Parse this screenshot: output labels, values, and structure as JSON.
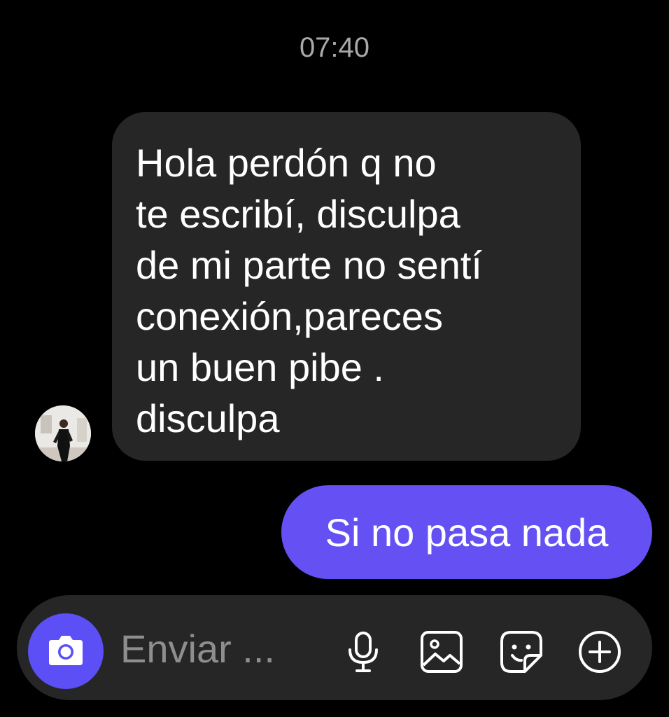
{
  "conversation": {
    "timestamp": "07:40"
  },
  "incoming_message": {
    "lines": [
      "Hola perdón q no",
      "te escribí, disculpa",
      "de mi parte no sentí",
      "conexión,pareces",
      "un buen pibe .",
      "disculpa"
    ]
  },
  "outgoing_message": {
    "text": "Si no pasa nada"
  },
  "composer": {
    "placeholder": "Enviar ...",
    "icons": [
      "camera-icon",
      "microphone-icon",
      "gallery-icon",
      "sticker-icon",
      "plus-icon"
    ]
  },
  "colors": {
    "background": "#000000",
    "incoming_bubble": "#262626",
    "outgoing_bubble": "#6551f3",
    "camera_button": "#5b4ff5",
    "timestamp_text": "#a9a9a9"
  }
}
